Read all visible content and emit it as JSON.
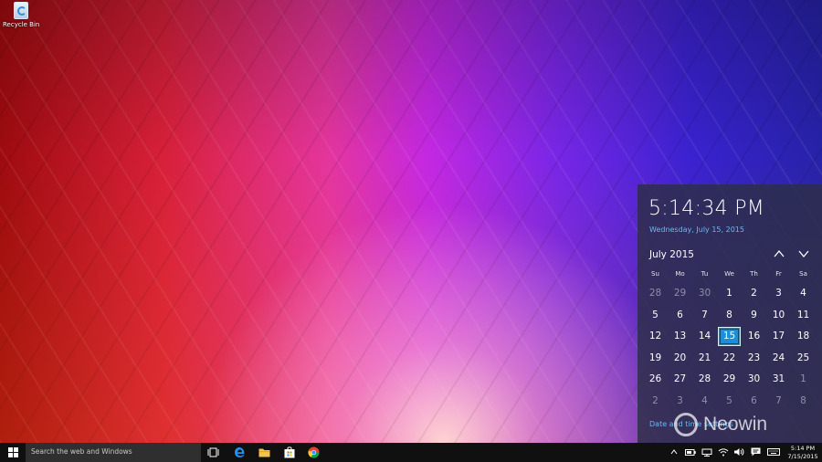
{
  "desktop": {
    "recycle_bin_label": "Recycle Bin"
  },
  "clock_flyout": {
    "time": "5:14:34 PM",
    "date": "Wednesday, July 15, 2015",
    "month_label": "July 2015",
    "weekdays": [
      "Su",
      "Mo",
      "Tu",
      "We",
      "Th",
      "Fr",
      "Sa"
    ],
    "weeks": [
      [
        "28",
        "29",
        "30",
        "1",
        "2",
        "3",
        "4"
      ],
      [
        "5",
        "6",
        "7",
        "8",
        "9",
        "10",
        "11"
      ],
      [
        "12",
        "13",
        "14",
        "15",
        "16",
        "17",
        "18"
      ],
      [
        "19",
        "20",
        "21",
        "22",
        "23",
        "24",
        "25"
      ],
      [
        "26",
        "27",
        "28",
        "29",
        "30",
        "31",
        "1"
      ],
      [
        "2",
        "3",
        "4",
        "5",
        "6",
        "7",
        "8"
      ]
    ],
    "settings_link": "Date and time settings",
    "accent_color": "#1c8fd6",
    "link_color": "#6fb7f0"
  },
  "taskbar": {
    "search_placeholder": "Search the web and Windows",
    "pinned": [
      "task-view-icon",
      "edge-icon",
      "file-explorer-icon",
      "store-icon",
      "chrome-icon"
    ],
    "tray": [
      "show-hidden-icons",
      "battery-icon",
      "network-icon",
      "wifi-icon",
      "volume-icon",
      "action-center-icon",
      "keyboard-icon"
    ],
    "clock_time": "5:14 PM",
    "clock_date": "7/15/2015"
  },
  "watermark": {
    "text": "Neowin"
  }
}
